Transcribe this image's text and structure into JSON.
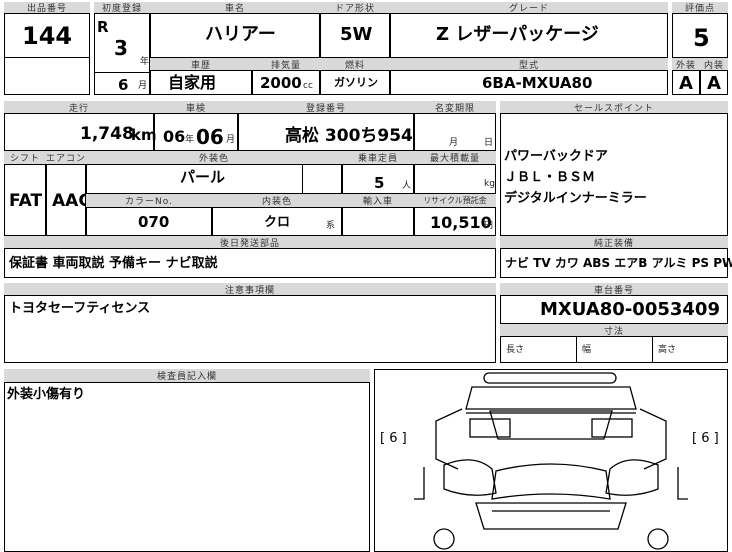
{
  "top": {
    "h_lot": "出品番号",
    "lot": "144",
    "h_reg": "初度登録",
    "era": "R",
    "year": "3",
    "year_unit": "年",
    "month": "6",
    "month_unit": "月",
    "h_name": "車名",
    "name": "ハリアー",
    "h_door": "ドア形状",
    "door": "5W",
    "h_grade": "グレード",
    "grade": "Z レザーパッケージ",
    "h_score": "評価点",
    "score": "5",
    "h_usage": "車歴",
    "usage": "自家用",
    "h_disp": "排気量",
    "disp": "2000",
    "disp_unit": "cc",
    "h_fuel": "燃料",
    "fuel": "ガソリン",
    "h_model": "型式",
    "model": "6BA-MXUA80",
    "h_ext": "外装",
    "ext": "A",
    "h_int": "内装",
    "int": "A"
  },
  "mid": {
    "h_mileage": "走行",
    "mileage": "1,748",
    "mileage_unit": "km",
    "h_inspect": "車検",
    "inspect_y": "06",
    "y_unit": "年",
    "inspect_m": "06",
    "m_unit": "月",
    "h_plate": "登録番号",
    "plate": "高松 300ち954",
    "h_expiry": "名変期限",
    "expiry_m": "月",
    "expiry_d": "日",
    "h_shift": "シフト",
    "shift": "FAT",
    "h_ac": "エアコン",
    "ac": "AAC",
    "h_color": "外装色",
    "color": "パール",
    "h_capacity": "乗車定員",
    "capacity": "5",
    "capacity_unit": "人",
    "h_load": "最大積載量",
    "load_unit": "kg",
    "h_colorno": "カラーNo.",
    "colorno": "070",
    "h_intcolor": "内装色",
    "intcolor": "クロ",
    "intcolor_unit": "系",
    "h_import": "輸入車",
    "h_recycle": "リサイクル預託金",
    "recycle": "10,510",
    "recycle_unit": "円"
  },
  "sales": {
    "header": "セールスポイント",
    "lines": [
      "パワーバックドア",
      "ＪＢＬ・ＢＳＭ",
      "デジタルインナーミラー"
    ]
  },
  "parts": {
    "header": "後日発送部品",
    "text": "保証書 車両取説 予備キー ナビ取説"
  },
  "equip": {
    "header": "純正装備",
    "text": "ナビ TV カワ ABS エアB アルミ PS PW"
  },
  "notes": {
    "header": "注意事項欄",
    "text": "トヨタセーフティセンス"
  },
  "chassis": {
    "header": "車台番号",
    "number": "MXUA80-0053409"
  },
  "dims": {
    "header": "寸法",
    "length": "長さ",
    "width": "幅",
    "height": "高さ"
  },
  "inspector": {
    "header": "検査員記入欄",
    "text": "外装小傷有り"
  },
  "diagram": {
    "tire_left": "[ 6 ]",
    "tire_right": "[ 6 ]"
  }
}
